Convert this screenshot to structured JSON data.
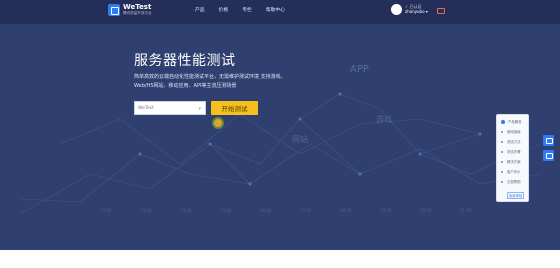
{
  "brand": {
    "name": "WeTest",
    "subtitle": "腾讯质量开放平台"
  },
  "nav": {
    "items": [
      "产品",
      "价格",
      "专栏",
      "帮助中心"
    ]
  },
  "user": {
    "status": "✓ 已认证",
    "name": "zhanyubo ▾"
  },
  "hero": {
    "headline": "服务器性能测试",
    "description": "简单高效的云端自动化性能测试平台，无需维护测试环境 支持游戏、Web/H5网站、移动应用、API等主流压测场景",
    "select_value": "WeTest",
    "select_caret": "▾",
    "start_label": "开始测试",
    "background_words": [
      "APP",
      "网站",
      "游戏"
    ],
    "background_numbers": [
      "12:00",
      "13:00",
      "14:00",
      "15:00",
      "16:00",
      "17:00",
      "18:00",
      "19:00",
      "20:00",
      "21:00"
    ]
  },
  "tool_panel": {
    "items": [
      "产品服务",
      "使用指南",
      "测试方法",
      "测试步骤",
      "解决方案",
      "客户评价",
      "文档帮助"
    ],
    "more_label": "免费体验"
  },
  "colors": {
    "hero_bg": "#2e3f70",
    "topbar_bg": "#232f58",
    "accent": "#2d7cf6",
    "button": "#f4c11f"
  }
}
